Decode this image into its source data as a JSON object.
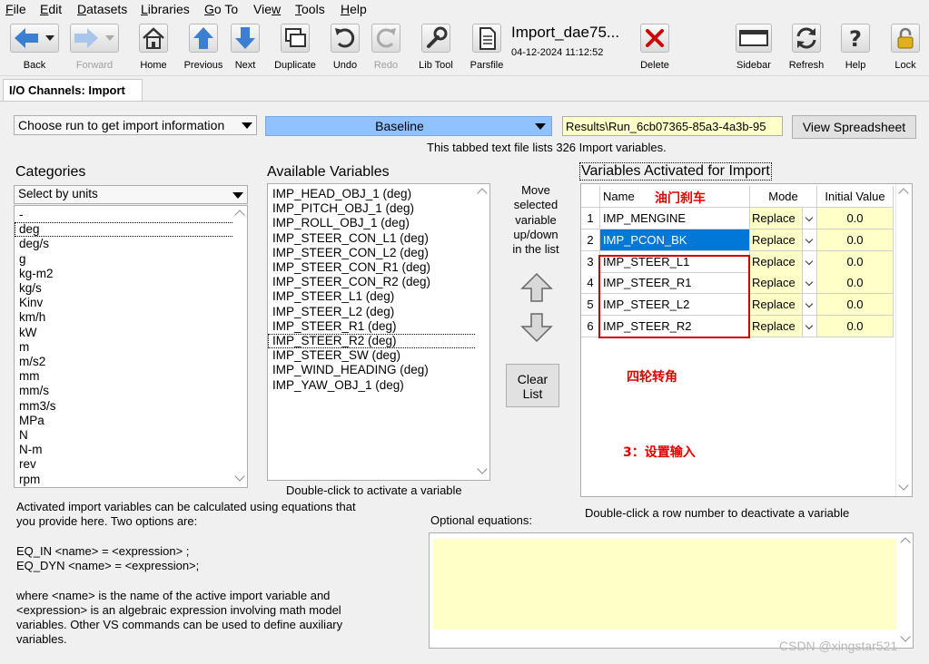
{
  "menu": [
    {
      "label": "File"
    },
    {
      "label": "Edit"
    },
    {
      "label": "Datasets"
    },
    {
      "label": "Libraries"
    },
    {
      "label": "Go To"
    },
    {
      "label": "View"
    },
    {
      "label": "Tools"
    },
    {
      "label": "Help"
    }
  ],
  "toolbar": {
    "back": "Back",
    "forward": "Forward",
    "home": "Home",
    "previous": "Previous",
    "next": "Next",
    "duplicate": "Duplicate",
    "undo": "Undo",
    "redo": "Redo",
    "lib_tool": "Lib Tool",
    "parsfile": "Parsfile",
    "delete": "Delete",
    "sidebar": "Sidebar",
    "refresh": "Refresh",
    "help": "Help",
    "lock": "Lock",
    "dataset_title": "Import_dae75...",
    "dataset_timestamp": "04-12-2024 11:12:52"
  },
  "tab": {
    "label": "I/O Channels: Import"
  },
  "run_select": {
    "value": "Choose run to get import information"
  },
  "baseline_select": {
    "value": "Baseline"
  },
  "results_path": "Results\\Run_6cb07365-85a3-4a3b-95",
  "view_spreadsheet": "View Spreadsheet",
  "file_info": "This tabbed text file lists 326 Import variables.",
  "categories": {
    "title": "Categories",
    "filter": "Select by units",
    "items": [
      "-",
      "deg",
      "deg/s",
      "g",
      "kg-m2",
      "kg/s",
      "Kinv",
      "km/h",
      "kW",
      "m",
      "m/s2",
      "mm",
      "mm/s",
      "mm3/s",
      "MPa",
      "N",
      "N-m",
      "rev",
      "rpm"
    ]
  },
  "available": {
    "title": "Available Variables",
    "items": [
      "IMP_HEAD_OBJ_1 (deg)",
      "IMP_PITCH_OBJ_1 (deg)",
      "IMP_ROLL_OBJ_1 (deg)",
      "IMP_STEER_CON_L1 (deg)",
      "IMP_STEER_CON_L2 (deg)",
      "IMP_STEER_CON_R1 (deg)",
      "IMP_STEER_CON_R2 (deg)",
      "IMP_STEER_L1 (deg)",
      "IMP_STEER_L2 (deg)",
      "IMP_STEER_R1 (deg)",
      "IMP_STEER_R2 (deg)",
      "IMP_STEER_SW (deg)",
      "IMP_WIND_HEADING (deg)",
      "IMP_YAW_OBJ_1 (deg)"
    ],
    "hint": "Double-click to activate a variable"
  },
  "move": {
    "line1": "Move",
    "line2": "selected",
    "line3": "variable",
    "line4": "up/down",
    "line5": "in the list",
    "clear_line1": "Clear",
    "clear_line2": "List"
  },
  "activated": {
    "title": "Variables Activated for Import",
    "headers": {
      "name": "Name",
      "mode": "Mode",
      "initial": "Initial Value"
    },
    "rows": [
      {
        "num": "1",
        "name": "IMP_MENGINE",
        "mode": "Replace",
        "initial": "0.0"
      },
      {
        "num": "2",
        "name": "IMP_PCON_BK",
        "mode": "Replace",
        "initial": "0.0"
      },
      {
        "num": "3",
        "name": "IMP_STEER_L1",
        "mode": "Replace",
        "initial": "0.0"
      },
      {
        "num": "4",
        "name": "IMP_STEER_R1",
        "mode": "Replace",
        "initial": "0.0"
      },
      {
        "num": "5",
        "name": "IMP_STEER_L2",
        "mode": "Replace",
        "initial": "0.0"
      },
      {
        "num": "6",
        "name": "IMP_STEER_R2",
        "mode": "Replace",
        "initial": "0.0"
      }
    ],
    "hint": "Double-click a row number to deactivate a variable"
  },
  "annotations": {
    "throttle_brake": "油门刹车",
    "wheel_angle": "四轮转角",
    "step3": "3：设置输入"
  },
  "help_text": {
    "l1": "Activated import variables can be calculated using equations that",
    "l2": "you provide here. Two options are:",
    "l3": "EQ_IN <name> = <expression> ;",
    "l4": "EQ_DYN <name> = <expression>;",
    "l5": "where <name> is the name of the active import variable and",
    "l6": "<expression> is an algebraic expression involving math model",
    "l7": "variables. Other VS commands can be used to define auxiliary",
    "l8": "variables."
  },
  "equations": {
    "label": "Optional equations:"
  },
  "watermark": "CSDN @xingstar521"
}
